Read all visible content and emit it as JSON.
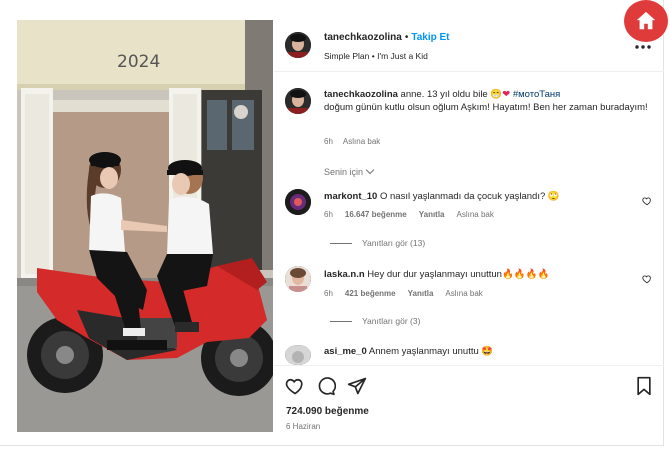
{
  "post": {
    "username": "tanechkaozolina",
    "follow_label": "Takip Et",
    "dot": "•",
    "music_artist": "Simple Plan",
    "music_song": "I'm Just a Kid",
    "photo_sign": "2024"
  },
  "caption": {
    "username": "tanechkaozolina",
    "text": " anne. 13 yıl oldu bile",
    "hashtag": "#мотоТаня",
    "text2": "doğum günün kutlu olsun oğlum Aşkım! Hayatım! Ben her zaman buradayım!",
    "time": "6h",
    "translate": "Aslına bak"
  },
  "filter": {
    "label": "Senin için"
  },
  "comments": [
    {
      "username": "markont_10",
      "text": " O nasıl yaşlanmadı da çocuk yaşlandı? ",
      "emoji": "🙄",
      "time": "6h",
      "likes": "16.647 beğenme",
      "reply": "Yanıtla",
      "translate": "Aslına bak",
      "replies": "Yanıtları gör (13)"
    },
    {
      "username": "laska.n.n",
      "text": " Hey dur dur yaşlanmayı unuttun",
      "emoji": "🔥🔥🔥🔥",
      "time": "6h",
      "likes": "421 beğenme",
      "reply": "Yanıtla",
      "translate": "Aslına bak",
      "replies": "Yanıtları gör (3)"
    },
    {
      "username": "asi_me_0",
      "text": " Annem yaşlanmayı unuttu ",
      "emoji": "🤩"
    }
  ],
  "footer": {
    "likes_total": "724.090 beğenme",
    "date": "6 Haziran"
  },
  "colors": {
    "accent_blue": "#0095f6",
    "home_button": "#e03b3b",
    "bike_red": "#d42a2a"
  },
  "icons": {
    "home": "home-icon",
    "more": "more-options-icon",
    "like": "heart-icon",
    "comment": "comment-icon",
    "share": "send-icon",
    "save": "bookmark-icon"
  }
}
